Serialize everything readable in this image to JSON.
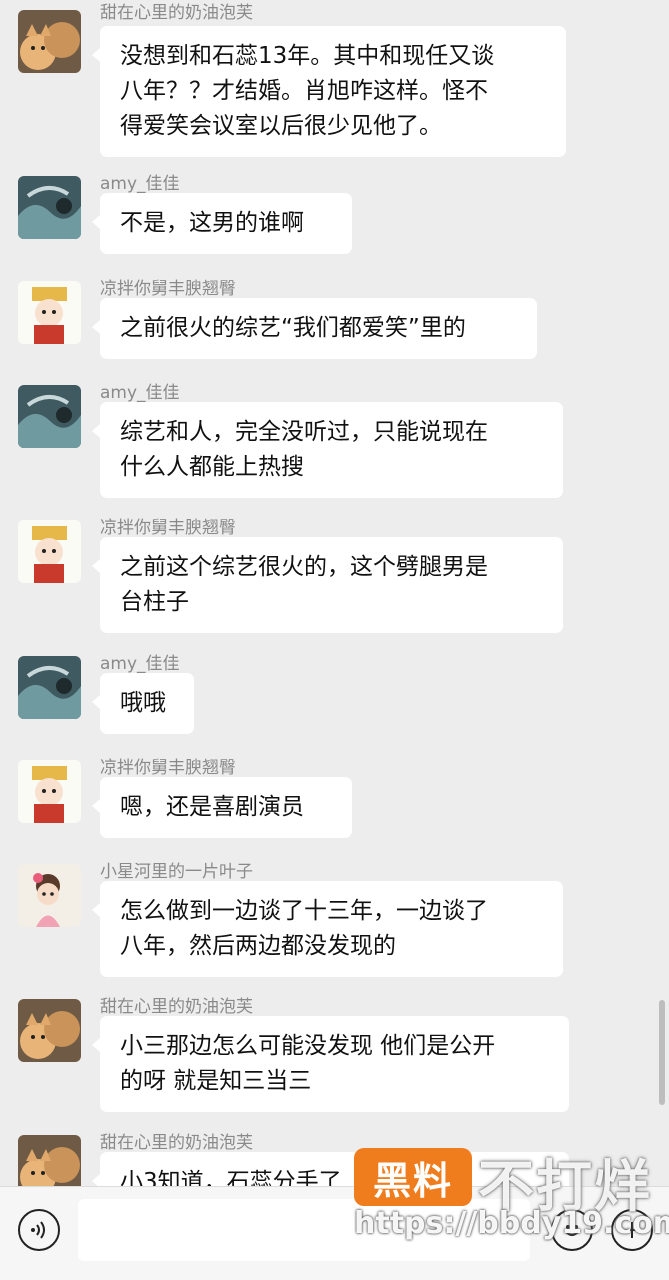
{
  "messages": [
    {
      "name": "甜在心里的奶油泡芙",
      "avatar": "cat-avatar",
      "lines": [
        "没想到和石蕊13年。其中和现任又谈",
        "八年？？才结婚。肖旭咋这样。怪不",
        "得爱笑会议室以后很少见他了。"
      ]
    },
    {
      "name": "amy_佳佳",
      "avatar": "storm-avatar",
      "lines": [
        "不是，这男的谁啊"
      ]
    },
    {
      "name": "凉拌你舅丰腴翘臀",
      "avatar": "cartoon-girl-avatar",
      "lines": [
        "之前很火的综艺“我们都爱笑”里的"
      ]
    },
    {
      "name": "amy_佳佳",
      "avatar": "storm-avatar",
      "lines": [
        "综艺和人，完全没听过，只能说现在",
        "什么人都能上热搜"
      ]
    },
    {
      "name": "凉拌你舅丰腴翘臀",
      "avatar": "cartoon-girl-avatar",
      "lines": [
        "之前这个综艺很火的，这个劈腿男是",
        "台柱子"
      ]
    },
    {
      "name": "amy_佳佳",
      "avatar": "storm-avatar",
      "lines": [
        "哦哦"
      ]
    },
    {
      "name": "凉拌你舅丰腴翘臀",
      "avatar": "cartoon-girl-avatar",
      "lines": [
        "嗯，还是喜剧演员"
      ]
    },
    {
      "name": "小星河里的一片叶子",
      "avatar": "girl-sticker-avatar",
      "lines": [
        "怎么做到一边谈了十三年，一边谈了",
        "八年，然后两边都没发现的"
      ]
    },
    {
      "name": "甜在心里的奶油泡芙",
      "avatar": "cat-avatar",
      "lines": [
        "小三那边怎么可能没发现 他们是公开",
        "的呀 就是知三当三"
      ]
    },
    {
      "name": "甜在心里的奶油泡芙",
      "avatar": "cat-avatar",
      "lines": [
        "小3知道，石蕊分手了"
      ]
    }
  ],
  "input_bar": {
    "placeholder": "",
    "voice_icon": "voice-icon",
    "emoji_icon": "emoji-icon",
    "plus_icon": "plus-icon"
  },
  "watermark": {
    "badge": "黑料",
    "title": "不打烊",
    "url": "https://bbdy19.com"
  },
  "colors": {
    "background": "#ededed",
    "bubble": "#ffffff",
    "name_text": "#8a8a8a",
    "watermark_badge": "#f07d1d"
  }
}
